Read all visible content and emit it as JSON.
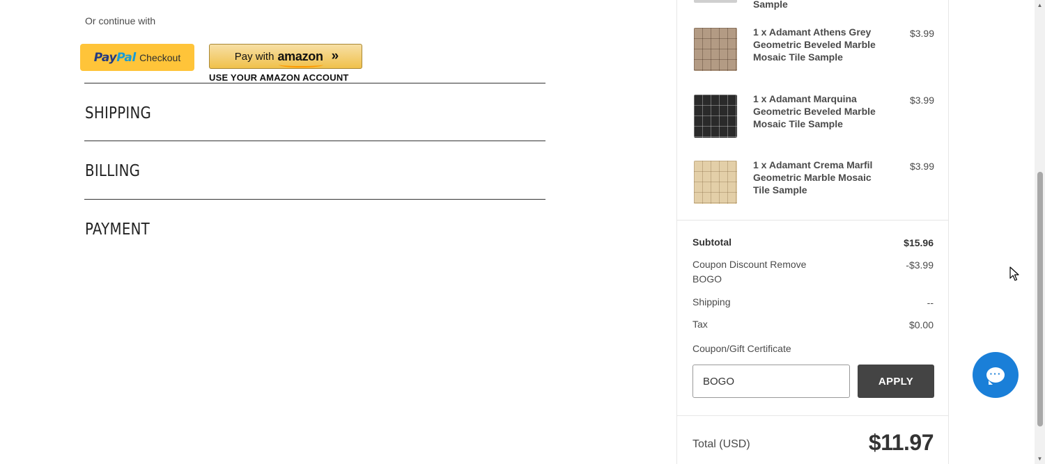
{
  "checkout": {
    "or_continue_with": "Or continue with",
    "paypal": {
      "brand_pay": "Pay",
      "brand_pal": "Pal",
      "label": "Checkout"
    },
    "amazon": {
      "pay_with": "Pay with",
      "brand": "amazon",
      "chevrons": "»",
      "caption": "USE YOUR AMAZON ACCOUNT"
    },
    "sections": [
      "SHIPPING",
      "BILLING",
      "PAYMENT"
    ]
  },
  "summary": {
    "partial_item": {
      "name_tail": "Sample"
    },
    "items": [
      {
        "name": "1 x Adamant Athens Grey Geometric Beveled Marble Mosaic Tile Sample",
        "price": "$3.99",
        "thumb": "tile-athens"
      },
      {
        "name": "1 x Adamant Marquina Geometric Beveled Marble Mosaic Tile Sample",
        "price": "$3.99",
        "thumb": "tile-marquina"
      },
      {
        "name": "1 x Adamant Crema Marfil Geometric Marble Mosaic Tile Sample",
        "price": "$3.99",
        "thumb": "tile-crema"
      }
    ],
    "subtotal": {
      "label": "Subtotal",
      "value": "$15.96"
    },
    "coupon_discount": {
      "label": "Coupon Discount",
      "remove": "Remove",
      "code": "BOGO",
      "value": "-$3.99"
    },
    "shipping": {
      "label": "Shipping",
      "value": "--"
    },
    "tax": {
      "label": "Tax",
      "value": "$0.00"
    },
    "coupon_field": {
      "label": "Coupon/Gift Certificate",
      "value": "BOGO",
      "apply_label": "APPLY"
    },
    "total": {
      "label": "Total (USD)",
      "value": "$11.97"
    }
  },
  "chat": {
    "icon": "chat-bubble-icon"
  },
  "colors": {
    "paypal_yellow": "#ffc439",
    "amazon_gold": "#f0c14b",
    "apply_bg": "#444444",
    "chat_blue": "#1a7fd8"
  }
}
